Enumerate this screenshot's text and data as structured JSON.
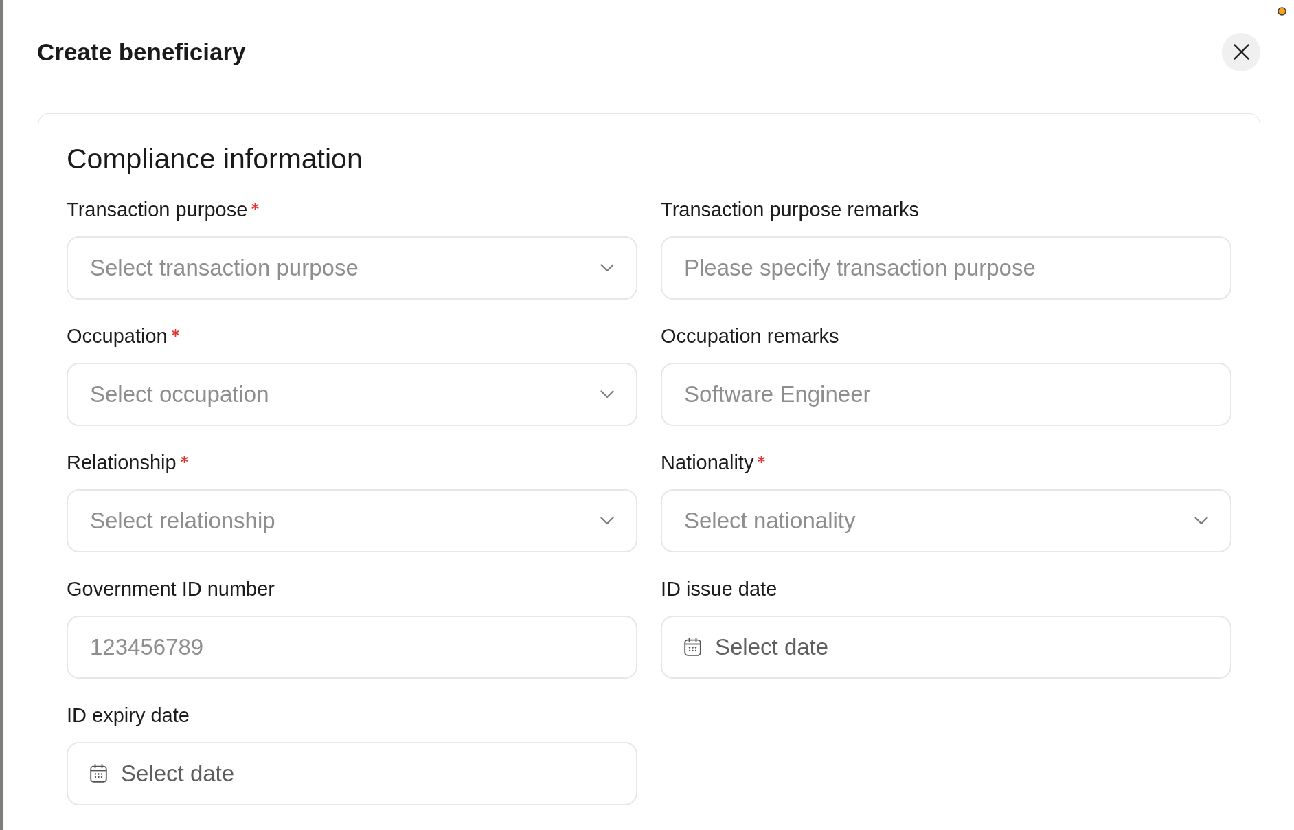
{
  "dialog": {
    "title": "Create beneficiary"
  },
  "section": {
    "title": "Compliance information",
    "fields": [
      {
        "kind": "select",
        "label": "Transaction purpose",
        "required": true,
        "placeholder": "Select transaction purpose"
      },
      {
        "kind": "text",
        "label": "Transaction purpose remarks",
        "required": false,
        "placeholder": "Please specify transaction purpose"
      },
      {
        "kind": "select",
        "label": "Occupation",
        "required": true,
        "placeholder": "Select occupation"
      },
      {
        "kind": "text",
        "label": "Occupation remarks",
        "required": false,
        "placeholder": "Software Engineer"
      },
      {
        "kind": "select",
        "label": "Relationship",
        "required": true,
        "placeholder": "Select relationship"
      },
      {
        "kind": "select",
        "label": "Nationality",
        "required": true,
        "placeholder": "Select nationality"
      },
      {
        "kind": "text",
        "label": "Government ID number",
        "required": false,
        "placeholder": "123456789"
      },
      {
        "kind": "date",
        "label": "ID issue date",
        "required": false,
        "placeholder": "Select date"
      },
      {
        "kind": "date",
        "label": "ID expiry date",
        "required": false,
        "placeholder": "Select date"
      }
    ]
  }
}
